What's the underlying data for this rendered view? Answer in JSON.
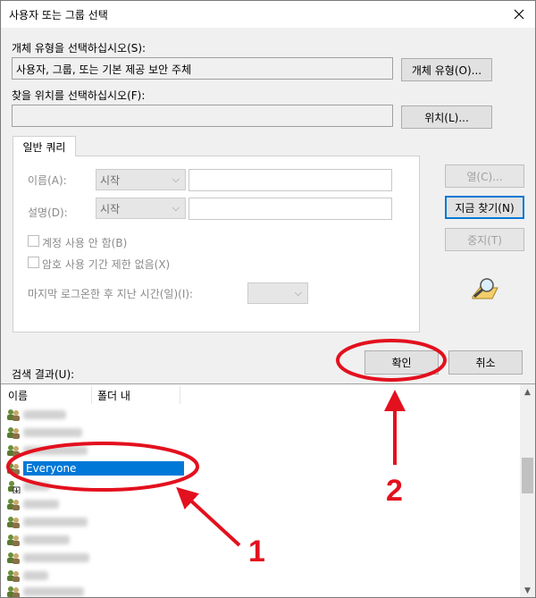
{
  "dialog": {
    "title": "사용자 또는 그룹 선택",
    "object_type_label": "개체 유형을 선택하십시오(S):",
    "object_type_value": "사용자, 그룹, 또는 기본 제공 보안 주체",
    "object_type_button": "개체 유형(O)...",
    "location_label": "찾을 위치를 선택하십시오(F):",
    "location_value": "",
    "location_button": "위치(L)...",
    "tab_label": "일반 쿼리",
    "name_label": "이름(A):",
    "name_combo": "시작",
    "desc_label": "설명(D):",
    "desc_combo": "시작",
    "disabled_accounts_label": "계정 사용 안 함(B)",
    "nonexpiring_pw_label": "암호 사용 기간 제한 없음(X)",
    "last_logon_label": "마지막 로그온한 후 지난 시간(일)(I):",
    "columns_button": "열(C)...",
    "find_now_button": "지금 찾기(N)",
    "stop_button": "중지(T)",
    "ok_button": "확인",
    "cancel_button": "취소",
    "results_label": "검색 결과(U):"
  },
  "results": {
    "columns": [
      "이름",
      "폴더 내"
    ],
    "selected_item": "Everyone"
  },
  "annotations": {
    "marker1": "1",
    "marker2": "2",
    "color": "#e3101e"
  }
}
